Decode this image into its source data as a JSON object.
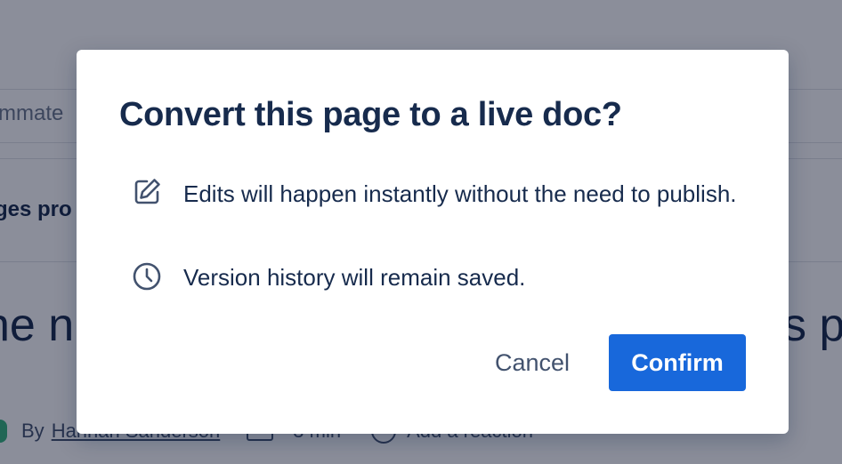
{
  "background": {
    "search_text": "mmate",
    "subnav_text": "ges pro",
    "title_left": "he n",
    "title_right": "s p",
    "byline_prefix": "By",
    "author": "Hannah Sanderson",
    "read_time": "3 min",
    "reaction_label": "Add a reaction"
  },
  "modal": {
    "title": "Convert this page to a live doc?",
    "items": [
      {
        "icon": "edit-icon",
        "text": "Edits will happen instantly without the need to publish."
      },
      {
        "icon": "clock-icon",
        "text": "Version history will remain saved."
      }
    ],
    "cancel_label": "Cancel",
    "confirm_label": "Confirm"
  },
  "colors": {
    "primary": "#1868db",
    "text": "#172b4d",
    "subtle_text": "#42526e",
    "overlay": "#090e28"
  }
}
